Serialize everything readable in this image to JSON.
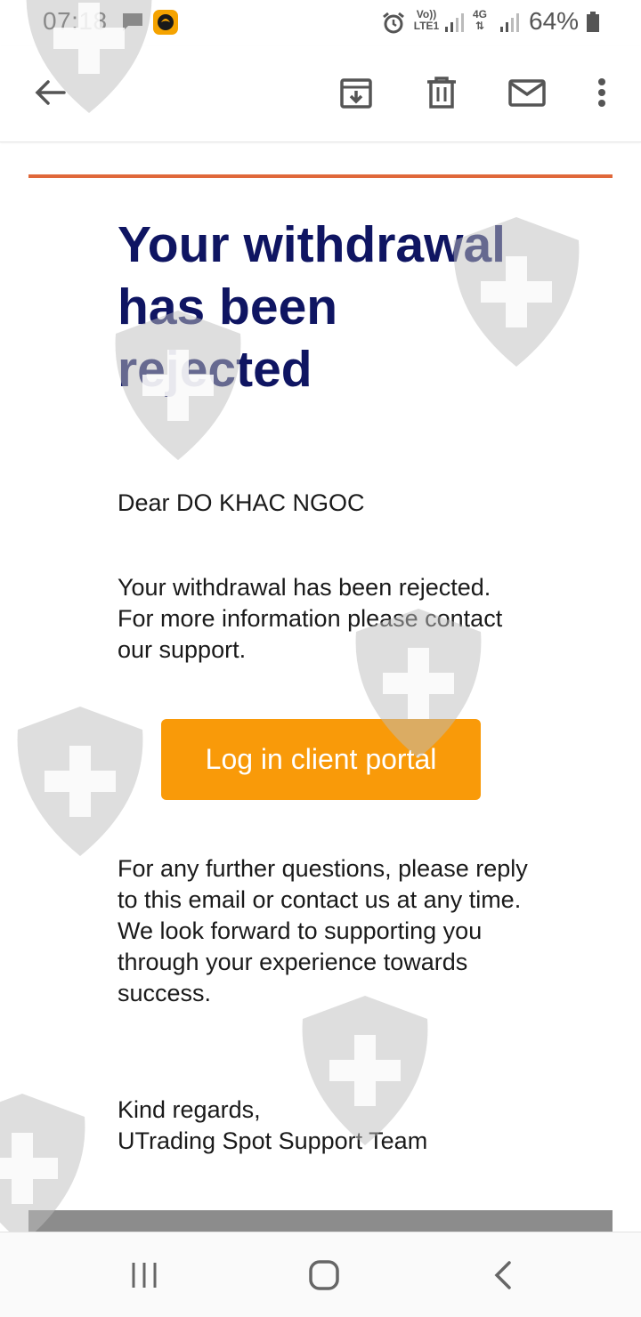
{
  "status_bar": {
    "time": "07:18",
    "volte_label_top": "Vo))",
    "volte_label_bottom": "LTE1",
    "network_label": "4G",
    "battery_percent": "64%",
    "icons": [
      "message-icon",
      "app-notification-icon",
      "alarm-icon",
      "signal-icon",
      "battery-icon"
    ]
  },
  "toolbar": {
    "icons": [
      "back-arrow-icon",
      "archive-icon",
      "trash-icon",
      "mark-unread-icon",
      "more-vert-icon"
    ]
  },
  "email": {
    "headline": "Your withdrawal has been rejected",
    "greeting": "Dear DO KHAC NGOC",
    "body_paragraph_1": "Your withdrawal has been rejected. For more information please contact our support.",
    "cta_label": "Log in client portal",
    "body_paragraph_2_line_1": "For any further questions, please reply to this email or contact us at any time.",
    "body_paragraph_2_line_2": "We look forward to supporting you through your experience towards success.",
    "closing": "Kind regards,",
    "signature": "UTrading Spot Support Team"
  },
  "navbar": {
    "icons": [
      "recents-icon",
      "home-icon",
      "back-icon"
    ]
  },
  "colors": {
    "headline": "#0f1562",
    "cta_background": "#f99a09",
    "accent_rule": "#e0683a",
    "footer_band": "#8c8c8c",
    "watermark": "#d4d4d4"
  }
}
